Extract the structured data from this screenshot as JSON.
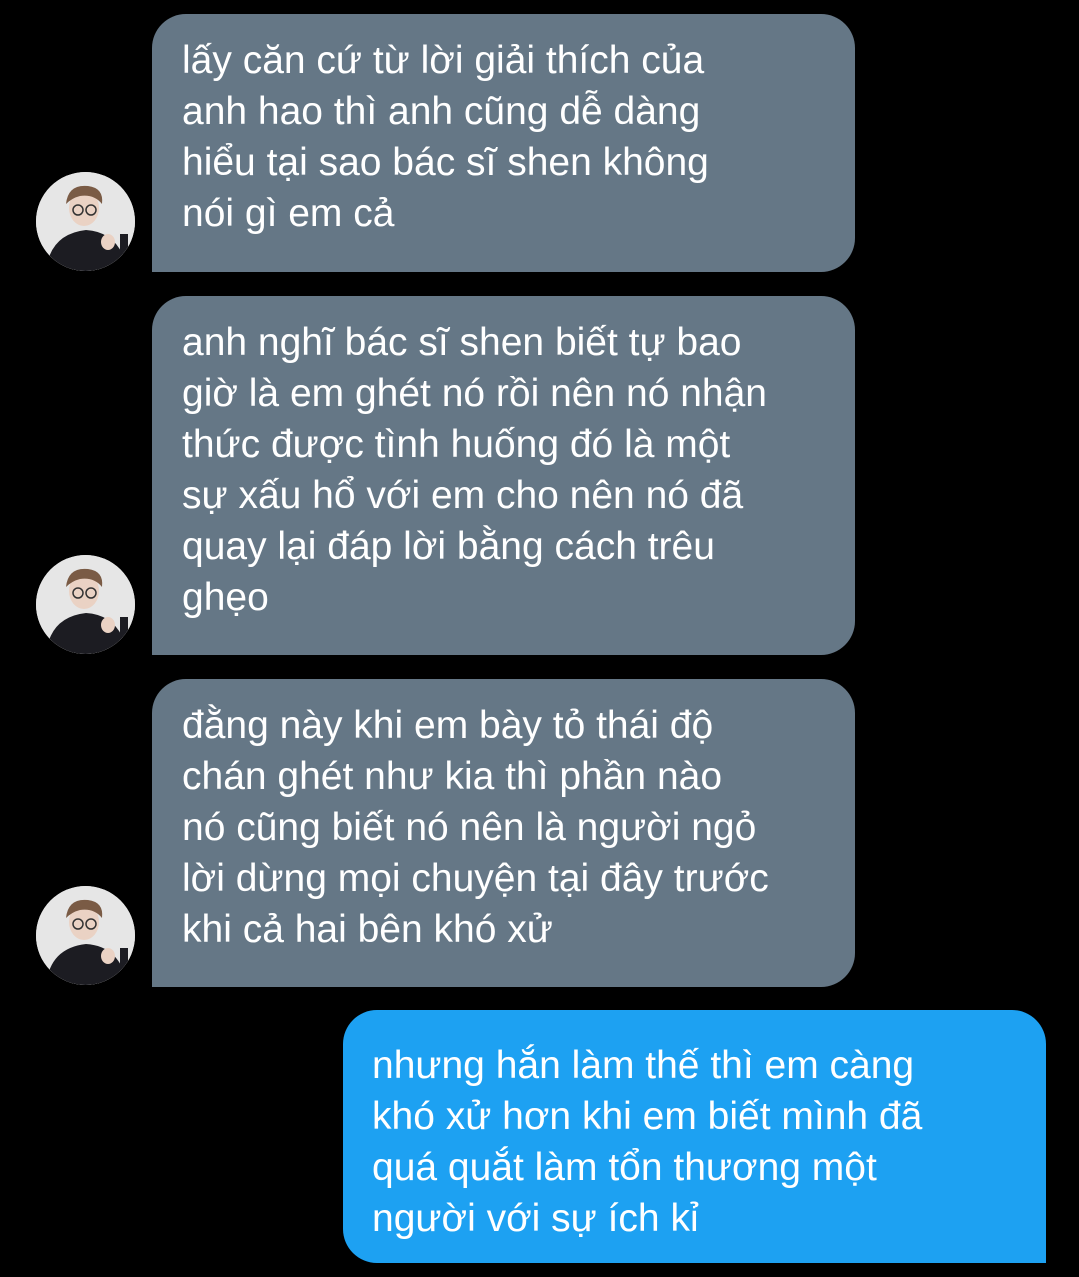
{
  "conversation": {
    "messages": [
      {
        "sender": "other",
        "lines": [
          "lấy căn cứ từ lời giải thích của",
          "anh hao thì anh cũng dễ dàng",
          "hiểu tại sao bác sĩ shen không",
          "nói gì em cả"
        ]
      },
      {
        "sender": "other",
        "lines": [
          "anh nghĩ bác sĩ shen biết tự bao",
          "giờ là em ghét nó rồi nên nó nhận",
          "thức được tình huống đó là một",
          "sự xấu hổ với em cho nên nó đã",
          "quay lại đáp lời bằng cách trêu",
          "ghẹo"
        ]
      },
      {
        "sender": "other",
        "lines": [
          "đằng này khi em bày tỏ thái độ",
          "chán ghét như kia thì phần nào",
          "nó cũng biết nó nên là người ngỏ",
          "lời dừng mọi chuyện tại đây trước",
          "khi cả hai bên khó xử"
        ]
      },
      {
        "sender": "me",
        "lines": [
          "nhưng hắn làm thế thì em càng",
          "khó xử hơn khi em biết mình đã",
          "quá quắt làm tổn thương một",
          "người với sự ích kỉ"
        ]
      }
    ]
  },
  "colors": {
    "background": "#000000",
    "incoming_bubble": "#657786",
    "outgoing_bubble": "#1da1f2",
    "text": "#ffffff"
  },
  "icons": {
    "avatar": "profile-photo-avatar"
  }
}
